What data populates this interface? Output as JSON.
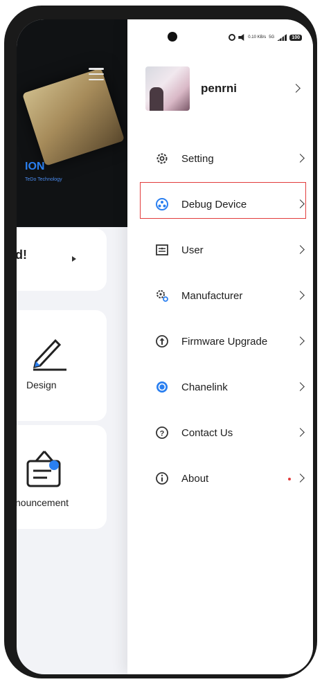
{
  "background_app": {
    "hero_title": "ION",
    "hero_subtitle": "TeDo Technology",
    "card1_text": "d!",
    "card2_label": "Design",
    "card3_label": "nouncement"
  },
  "drawer": {
    "status": {
      "speed": "0.10 KB/s",
      "network": "5G",
      "battery": "100"
    },
    "profile": {
      "name": "penrni"
    },
    "menu": [
      {
        "label": "Setting",
        "icon": "gear-icon"
      },
      {
        "label": "Debug Device",
        "icon": "debug-device-icon"
      },
      {
        "label": "User",
        "icon": "user-card-icon"
      },
      {
        "label": "Manufacturer",
        "icon": "manufacturer-icon"
      },
      {
        "label": "Firmware Upgrade",
        "icon": "firmware-upgrade-icon"
      },
      {
        "label": "Chanelink",
        "icon": "chanelink-icon"
      },
      {
        "label": "Contact Us",
        "icon": "help-icon"
      },
      {
        "label": "About",
        "icon": "info-icon"
      }
    ]
  },
  "colors": {
    "accent_blue": "#2a7ff0",
    "highlight_red": "#e23b3b"
  }
}
